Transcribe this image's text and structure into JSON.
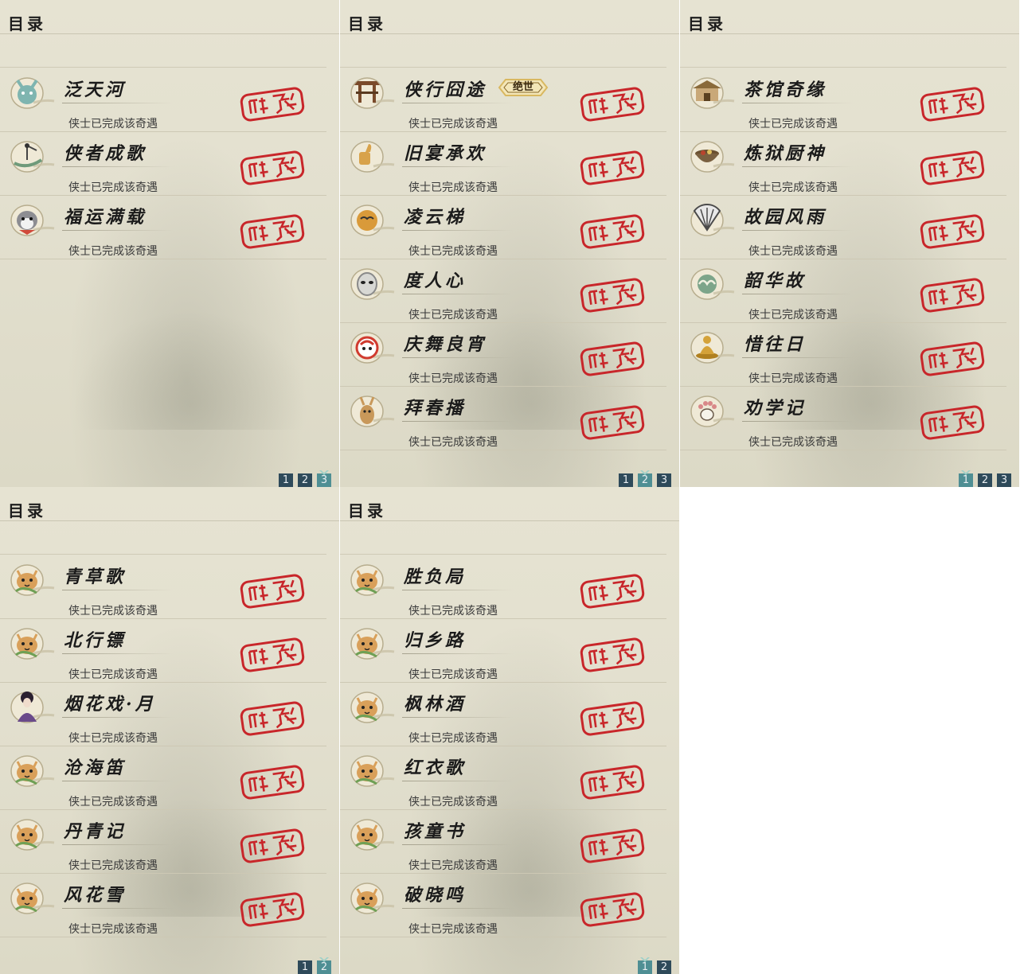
{
  "status_text": "侠士已完成该奇遇",
  "panels": [
    {
      "title": "目录",
      "items": [
        {
          "name": "泛天河",
          "icon": "fox-spirit-icon",
          "accent": "#7fb5b0"
        },
        {
          "name": "侠者成歌",
          "icon": "boat-fisherman-icon",
          "accent": "#6f9a7a"
        },
        {
          "name": "福运满载",
          "icon": "husky-dog-icon",
          "accent": "#d0493a"
        }
      ],
      "pages": [
        {
          "label": "1"
        },
        {
          "label": "2"
        },
        {
          "label": "3"
        }
      ],
      "active_page": 3
    },
    {
      "title": "目录",
      "items": [
        {
          "name": "侠行囧途",
          "icon": "pagoda-gate-icon",
          "accent": "#7a4a2a",
          "badge": "绝世"
        },
        {
          "name": "旧宴承欢",
          "icon": "thumbs-up-icon",
          "accent": "#d8a24a"
        },
        {
          "name": "凌云梯",
          "icon": "round-face-icon",
          "accent": "#d99a3a"
        },
        {
          "name": "度人心",
          "icon": "mask-face-icon",
          "accent": "#8a8a8a"
        },
        {
          "name": "庆舞良宵",
          "icon": "lion-dance-icon",
          "accent": "#d03b2f"
        },
        {
          "name": "拜春播",
          "icon": "deer-icon",
          "accent": "#c8985a"
        }
      ],
      "pages": [
        {
          "label": "1"
        },
        {
          "label": "2"
        },
        {
          "label": "3"
        }
      ],
      "active_page": 2
    },
    {
      "title": "目录",
      "items": [
        {
          "name": "茶馆奇缘",
          "icon": "teahouse-icon",
          "accent": "#8a6a3a"
        },
        {
          "name": "炼狱厨神",
          "icon": "cauldron-icon",
          "accent": "#b9442e"
        },
        {
          "name": "故园风雨",
          "icon": "folding-fan-icon",
          "accent": "#4a4a4a"
        },
        {
          "name": "韶华故",
          "icon": "jade-cloud-icon",
          "accent": "#7da58a"
        },
        {
          "name": "惜往日",
          "icon": "golden-buddha-icon",
          "accent": "#d4a23a"
        },
        {
          "name": "劝学记",
          "icon": "paw-print-icon",
          "accent": "#6a5a4a"
        }
      ],
      "pages": [
        {
          "label": "1"
        },
        {
          "label": "2"
        },
        {
          "label": "3"
        }
      ],
      "active_page": 1
    },
    {
      "title": "目录",
      "items": [
        {
          "name": "青草歌",
          "icon": "cat-face-icon",
          "accent": "#d9a05a"
        },
        {
          "name": "北行镖",
          "icon": "cat-face-icon",
          "accent": "#d9a05a"
        },
        {
          "name": "烟花戏·月",
          "icon": "lady-portrait-icon",
          "accent": "#6a4a8a"
        },
        {
          "name": "沧海笛",
          "icon": "cat-face-icon",
          "accent": "#d9a05a"
        },
        {
          "name": "丹青记",
          "icon": "cat-face-icon",
          "accent": "#d9a05a"
        },
        {
          "name": "风花雪",
          "icon": "cat-face-icon",
          "accent": "#d9a05a"
        }
      ],
      "pages": [
        {
          "label": "1"
        },
        {
          "label": "2"
        }
      ],
      "active_page": 2
    },
    {
      "title": "目录",
      "items": [
        {
          "name": "胜负局",
          "icon": "cat-face-icon",
          "accent": "#d9a05a"
        },
        {
          "name": "归乡路",
          "icon": "cat-face-icon",
          "accent": "#d9a05a"
        },
        {
          "name": "枫林酒",
          "icon": "cat-face-icon",
          "accent": "#d9a05a"
        },
        {
          "name": "红衣歌",
          "icon": "cat-face-icon",
          "accent": "#d9a05a"
        },
        {
          "name": "孩童书",
          "icon": "cat-face-icon",
          "accent": "#d9a05a"
        },
        {
          "name": "破晓鸣",
          "icon": "cat-face-icon",
          "accent": "#d9a05a"
        }
      ],
      "pages": [
        {
          "label": "1"
        },
        {
          "label": "2"
        }
      ],
      "active_page": 1
    }
  ],
  "colors": {
    "stamp_red": "#c8262a",
    "page_button": "#2e4a5a",
    "page_button_active": "#4f8f94",
    "badge_gold": "#d9b860"
  }
}
